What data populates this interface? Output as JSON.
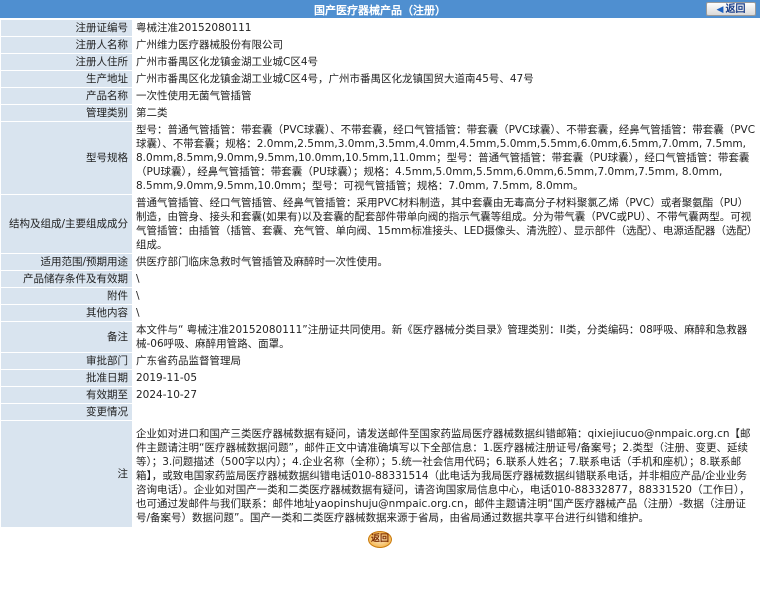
{
  "header": {
    "title": "国产医疗器械产品（注册）",
    "back_label": "返回"
  },
  "rows": [
    {
      "label": "注册证编号",
      "value": "粤械注准20152080111"
    },
    {
      "label": "注册人名称",
      "value": "广州维力医疗器械股份有限公司"
    },
    {
      "label": "注册人住所",
      "value": "广州市番禺区化龙镇金湖工业城C区4号"
    },
    {
      "label": "生产地址",
      "value": "广州市番禺区化龙镇金湖工业城C区4号，广州市番禺区化龙镇国贸大道南45号、47号"
    },
    {
      "label": "产品名称",
      "value": "一次性使用无菌气管插管"
    },
    {
      "label": "管理类别",
      "value": "第二类"
    },
    {
      "label": "型号规格",
      "value": "型号：普通气管插管：带套囊（PVC球囊）、不带套囊，经口气管插管：带套囊（PVC球囊）、不带套囊，经鼻气管插管：带套囊（PVC球囊）、不带套囊；规格：2.0mm,2.5mm,3.0mm,3.5mm,4.0mm,4.5mm,5.0mm,5.5mm,6.0mm,6.5mm,7.0mm, 7.5mm, 8.0mm,8.5mm,9.0mm,9.5mm,10.0mm,10.5mm,11.0mm；型号：普通气管插管：带套囊（PU球囊），经口气管插管：带套囊（PU球囊），经鼻气管插管：带套囊（PU球囊）；规格：4.5mm,5.0mm,5.5mm,6.0mm,6.5mm,7.0mm,7.5mm, 8.0mm, 8.5mm,9.0mm,9.5mm,10.0mm；型号：可视气管插管；规格：7.0mm, 7.5mm, 8.0mm。"
    },
    {
      "label": "结构及组成/主要组成成分",
      "value": "普通气管插管、经口气管插管、经鼻气管插管：采用PVC材料制造，其中套囊由无毒高分子材料聚氯乙烯（PVC）或者聚氨酯（PU）制造，由管身、接头和套囊(如果有)以及套囊的配套部件带单向阀的指示气囊等组成。分为带气囊（PVC或PU）、不带气囊两型。可视气管插管：由插管（插管、套囊、充气管、单向阀、15mm标准接头、LED摄像头、清洗腔）、显示部件（选配）、电源适配器（选配）组成。"
    },
    {
      "label": "适用范围/预期用途",
      "value": "供医疗部门临床急救时气管插管及麻醉时一次性使用。"
    },
    {
      "label": "产品储存条件及有效期",
      "value": "\\"
    },
    {
      "label": "附件",
      "value": "\\"
    },
    {
      "label": "其他内容",
      "value": "\\"
    },
    {
      "label": "备注",
      "value": "本文件与“ 粤械注准20152080111”注册证共同使用。新《医疗器械分类目录》管理类别：II类，分类编码：08呼吸、麻醉和急救器械-06呼吸、麻醉用管路、面罩。"
    },
    {
      "label": "审批部门",
      "value": "广东省药品监督管理局"
    },
    {
      "label": "批准日期",
      "value": "2019-11-05"
    },
    {
      "label": "有效期至",
      "value": "2024-10-27"
    },
    {
      "label": "变更情况",
      "value": ""
    },
    {
      "label": "注",
      "value": "企业如对进口和国产三类医疗器械数据有疑问，请发送邮件至国家药监局医疗器械数据纠错邮箱：qixiejiucuo@nmpaic.org.cn【邮件主题请注明“医疗器械数据问题”，邮件正文中请准确填写以下全部信息：1.医疗器械注册证号/备案号；2.类型（注册、变更、延续等）；3.问题描述（500字以内）；4.企业名称（全称）；5.统一社会信用代码；6.联系人姓名；7.联系电话（手机和座机）；8.联系邮箱】，或致电国家药监局医疗器械数据纠错电话010-88331514（此电话为我局医疗器械数据纠错联系电话，并非相应产品/企业业务咨询电话）。企业如对国产一类和二类医疗器械数据有疑问，请咨询国家局信息中心，电话010-88332877，88331520（工作日），也可通过发邮件与我们联系：邮件地址yaopinshuju@nmpaic.org.cn，邮件主题请注明“国产医疗器械产品（注册）-数据（注册证号/备案号）数据问题”。国产一类和二类医疗器械数据来源于省局，由省局通过数据共享平台进行纠错和维护。"
    }
  ],
  "footer": {
    "back_label": "返回"
  }
}
